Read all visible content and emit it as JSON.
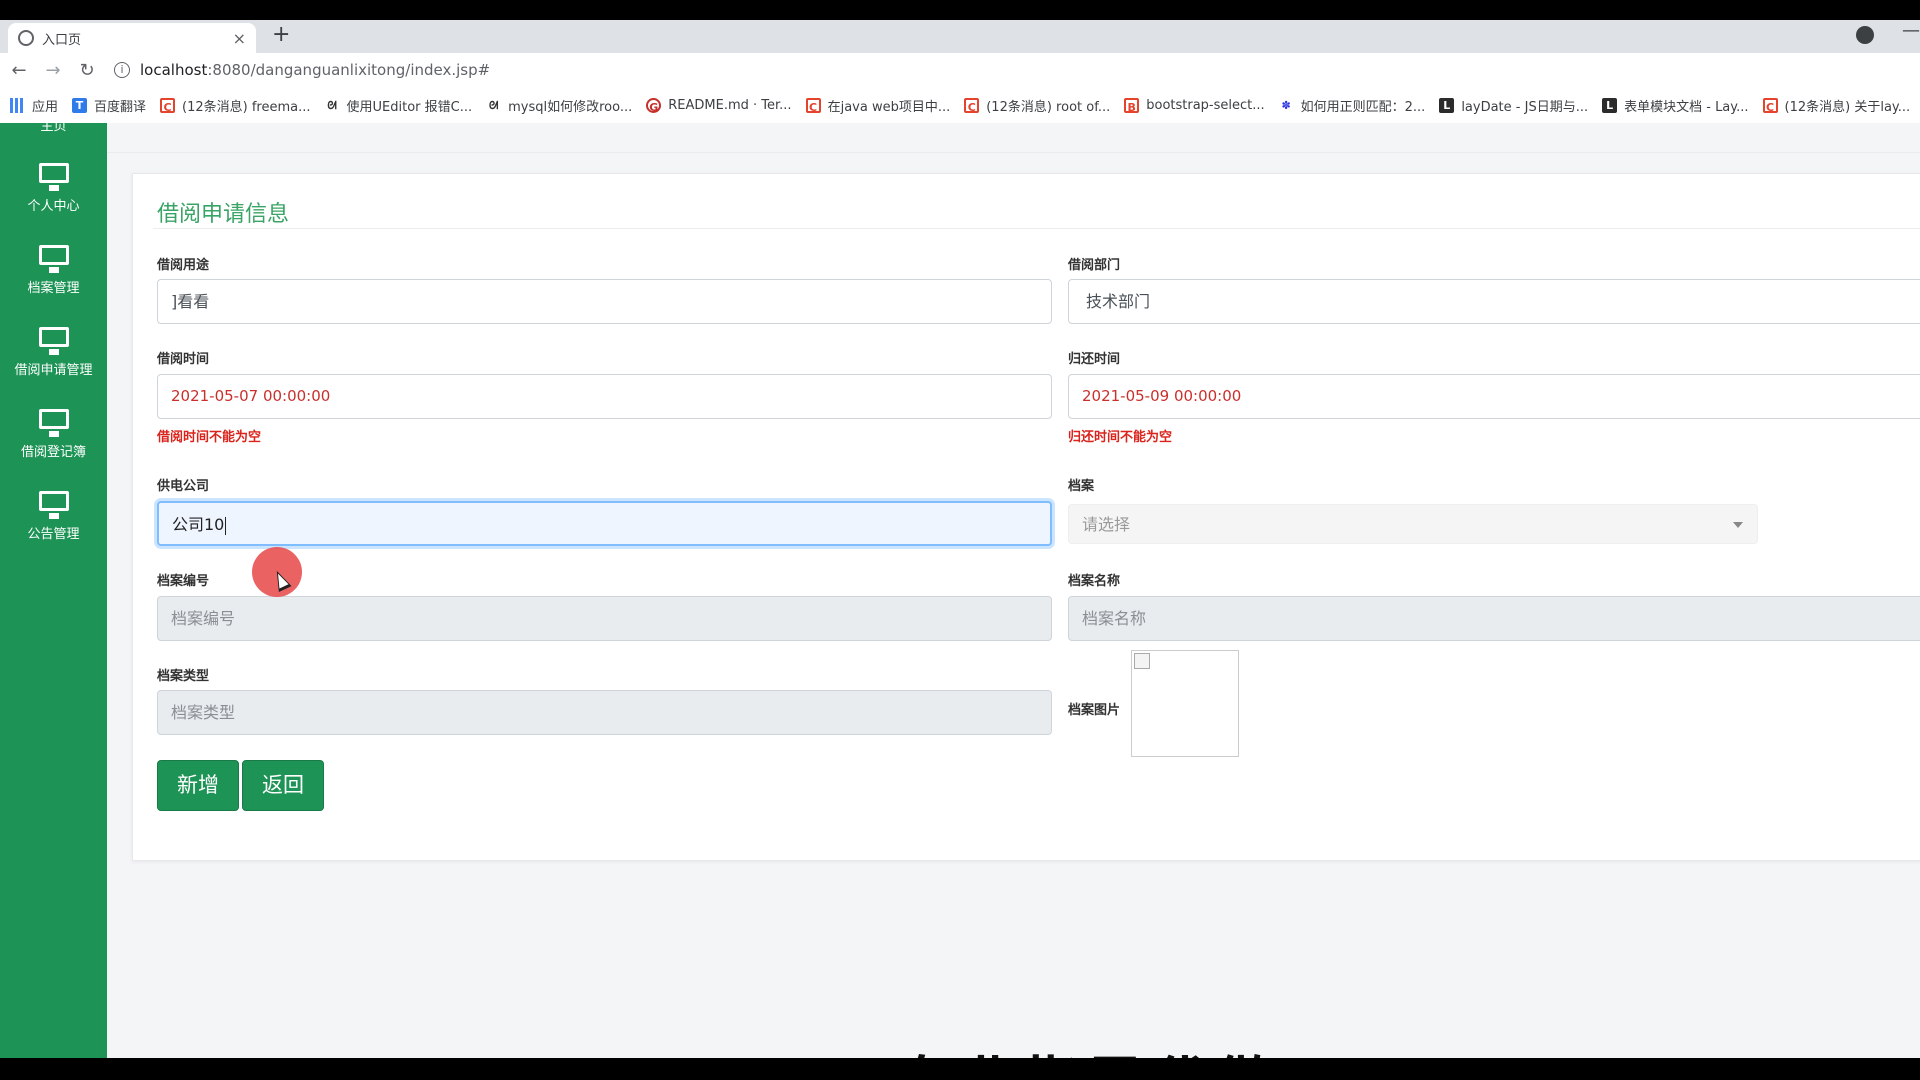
{
  "browser": {
    "tab_title": "入口页",
    "close_glyph": "×",
    "new_tab_glyph": "+",
    "url_host": "localhost",
    "url_path": ":8080/danganguanlixitong/index.jsp#",
    "back_glyph": "←",
    "forward_glyph": "→",
    "reload_glyph": "↻",
    "minimize_glyph": "—",
    "bookmarks": [
      {
        "label": "应用",
        "icon": "apps-icon"
      },
      {
        "label": "百度翻译",
        "icon": "baidu-translate-icon"
      },
      {
        "label": "(12条消息) freema...",
        "icon": "csdn-icon"
      },
      {
        "label": "使用UEditor 报错C...",
        "icon": "swirl-icon"
      },
      {
        "label": "mysql如何修改roo...",
        "icon": "swirl-icon"
      },
      {
        "label": "README.md · Ter...",
        "icon": "gitee-icon"
      },
      {
        "label": "在java web项目中...",
        "icon": "csdn-icon"
      },
      {
        "label": "(12条消息) root of...",
        "icon": "csdn-icon"
      },
      {
        "label": "bootstrap-select...",
        "icon": "bootstrap-icon"
      },
      {
        "label": "如何用正则匹配：2...",
        "icon": "baidu-paw-icon"
      },
      {
        "label": "layDate - JS日期与...",
        "icon": "layui-icon"
      },
      {
        "label": "表单模块文档 - Lay...",
        "icon": "layui-icon"
      },
      {
        "label": "(12条消息) 关于lay...",
        "icon": "csdn-icon"
      }
    ]
  },
  "sidebar": {
    "cut_label": "主页",
    "items": [
      {
        "label": "个人中心"
      },
      {
        "label": "档案管理"
      },
      {
        "label": "借阅申请管理"
      },
      {
        "label": "借阅登记簿"
      },
      {
        "label": "公告管理"
      }
    ]
  },
  "form": {
    "title": "借阅申请信息",
    "purpose_label": "借阅用途",
    "purpose_value": "]看看",
    "dept_label": "借阅部门",
    "dept_value": "技术部门",
    "borrow_time_label": "借阅时间",
    "borrow_time_value": "2021-05-07 00:00:00",
    "borrow_time_error": "借阅时间不能为空",
    "return_time_label": "归还时间",
    "return_time_value": "2021-05-09 00:00:00",
    "return_time_error": "归还时间不能为空",
    "company_label": "供电公司",
    "company_value": "公司10",
    "archive_label": "档案",
    "archive_select_placeholder": "请选择",
    "archive_no_label": "档案编号",
    "archive_no_placeholder": "档案编号",
    "archive_name_label": "档案名称",
    "archive_name_placeholder": "档案名称",
    "archive_type_label": "档案类型",
    "archive_type_placeholder": "档案类型",
    "archive_image_label": "档案图片",
    "add_button": "新增",
    "back_button": "返回"
  },
  "overlay": {
    "subtitle": "专业指导代做"
  },
  "colors": {
    "sidebar": "#1d9356",
    "title": "#3aa366",
    "error": "#d9231b",
    "date_text": "#c9302c"
  }
}
